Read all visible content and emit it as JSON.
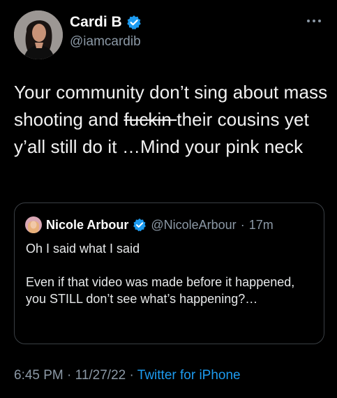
{
  "author": {
    "display_name": "Cardi B",
    "handle": "@iamcardib",
    "verified": true
  },
  "tweet": {
    "text_before": "Your community don’t sing about mass shooting and ",
    "text_struck": "fuckin ",
    "text_after": "their cousins yet y’all still do it …Mind your pink neck"
  },
  "quoted_tweet": {
    "display_name": "Nicole Arbour",
    "handle": "@NicoleArbour",
    "separator": "·",
    "time": "17m",
    "verified": true,
    "line1": "Oh I said what I said",
    "line2": "Even if that video was made before it happened, you STILL don’t see what’s happening?…"
  },
  "meta": {
    "time": "6:45 PM",
    "separator1": " · ",
    "date": "11/27/22",
    "separator2": " · ",
    "source": "Twitter for iPhone"
  },
  "icons": {
    "verified": "verified-badge-icon",
    "more": "more-dots-icon"
  },
  "colors": {
    "background": "#000000",
    "text": "#e7e9ea",
    "secondary": "#8b98a5",
    "accent": "#1d9bf0",
    "border": "#3a3f44"
  }
}
